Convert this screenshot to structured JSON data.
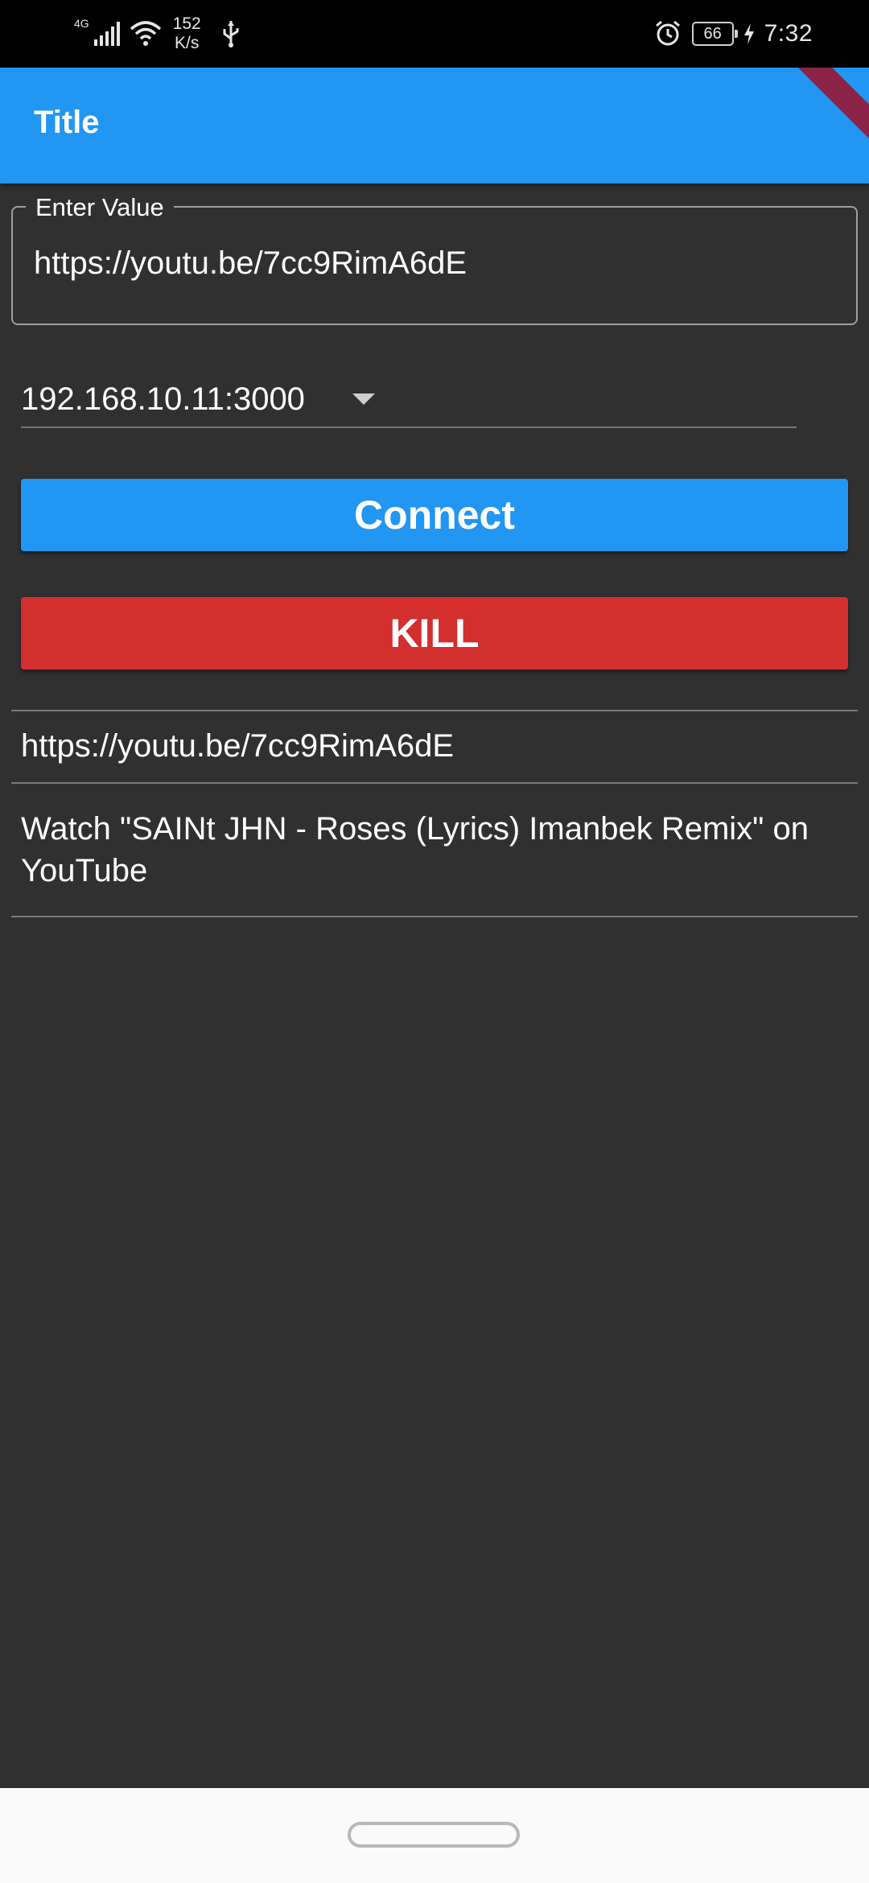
{
  "status_bar": {
    "network_type": "4G",
    "speed_value": "152",
    "speed_unit": "K/s",
    "battery": "66",
    "time": "7:32",
    "icons": [
      "signal-icon",
      "wifi-icon",
      "usb-icon",
      "alarm-icon",
      "battery-icon",
      "charging-icon"
    ]
  },
  "app_bar": {
    "title": "Title"
  },
  "input": {
    "label": "Enter Value",
    "value": "https://youtu.be/7cc9RimA6dE"
  },
  "dropdown": {
    "selected": "192.168.10.11:3000"
  },
  "buttons": {
    "connect": "Connect",
    "kill": "KILL"
  },
  "list": {
    "items": [
      "https://youtu.be/7cc9RimA6dE",
      "Watch \"SAINt JHN - Roses (Lyrics) Imanbek Remix\" on YouTube"
    ]
  },
  "colors": {
    "primary": "#2196f3",
    "danger": "#d32f2f",
    "background": "#303030",
    "debug_banner": "#8b2346"
  }
}
